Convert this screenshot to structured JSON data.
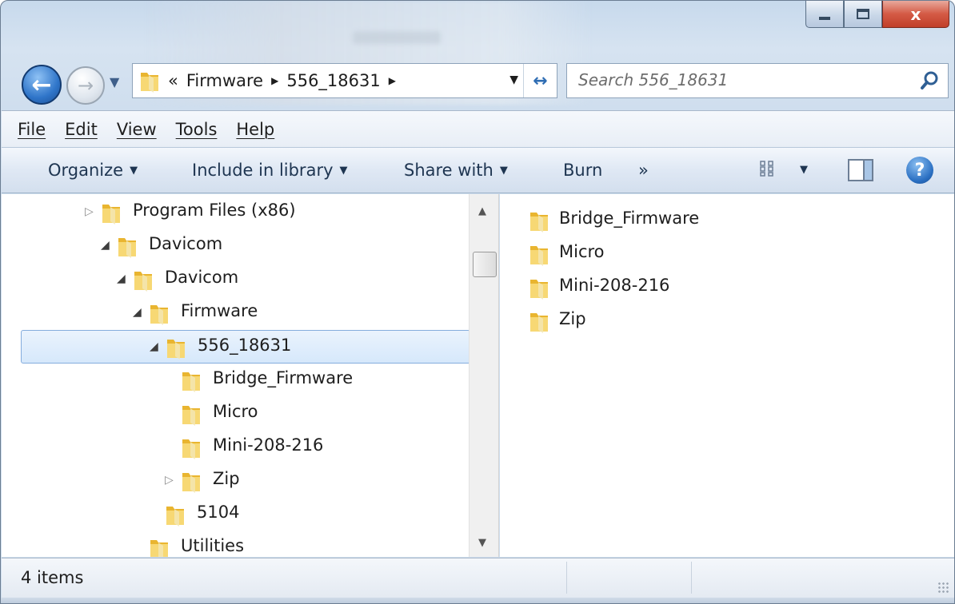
{
  "window": {
    "minimize_label": "",
    "maximize_label": "",
    "close_label": "x"
  },
  "address_bar": {
    "overflow": "«",
    "path": [
      "Firmware",
      "556_18631"
    ]
  },
  "search": {
    "placeholder": "Search 556_18631"
  },
  "menu": [
    "File",
    "Edit",
    "View",
    "Tools",
    "Help"
  ],
  "toolbar": {
    "organize": "Organize",
    "include_in_library": "Include in library",
    "share_with": "Share with",
    "burn": "Burn",
    "more": "»",
    "help": "?"
  },
  "tree": [
    {
      "label": "Program Files (x86)",
      "indent": 0,
      "state": "collapsed"
    },
    {
      "label": "Davicom",
      "indent": 1,
      "state": "expanded"
    },
    {
      "label": "Davicom",
      "indent": 2,
      "state": "expanded"
    },
    {
      "label": "Firmware",
      "indent": 3,
      "state": "expanded"
    },
    {
      "label": "556_18631",
      "indent": 4,
      "state": "expanded",
      "selected": true
    },
    {
      "label": "Bridge_Firmware",
      "indent": 5,
      "state": "none"
    },
    {
      "label": "Micro",
      "indent": 5,
      "state": "none"
    },
    {
      "label": "Mini-208-216",
      "indent": 5,
      "state": "none"
    },
    {
      "label": "Zip",
      "indent": 5,
      "state": "collapsed"
    },
    {
      "label": "5104",
      "indent": 4,
      "state": "none"
    },
    {
      "label": "Utilities",
      "indent": 3,
      "state": "none"
    }
  ],
  "content_items": [
    "Bridge_Firmware",
    "Micro",
    "Mini-208-216",
    "Zip"
  ],
  "status": {
    "item_count": "4 items"
  },
  "colors": {
    "selection_border": "#84acdd",
    "folder_yellow": "#f2c94c",
    "chrome_blue": "#d6e3f1"
  }
}
